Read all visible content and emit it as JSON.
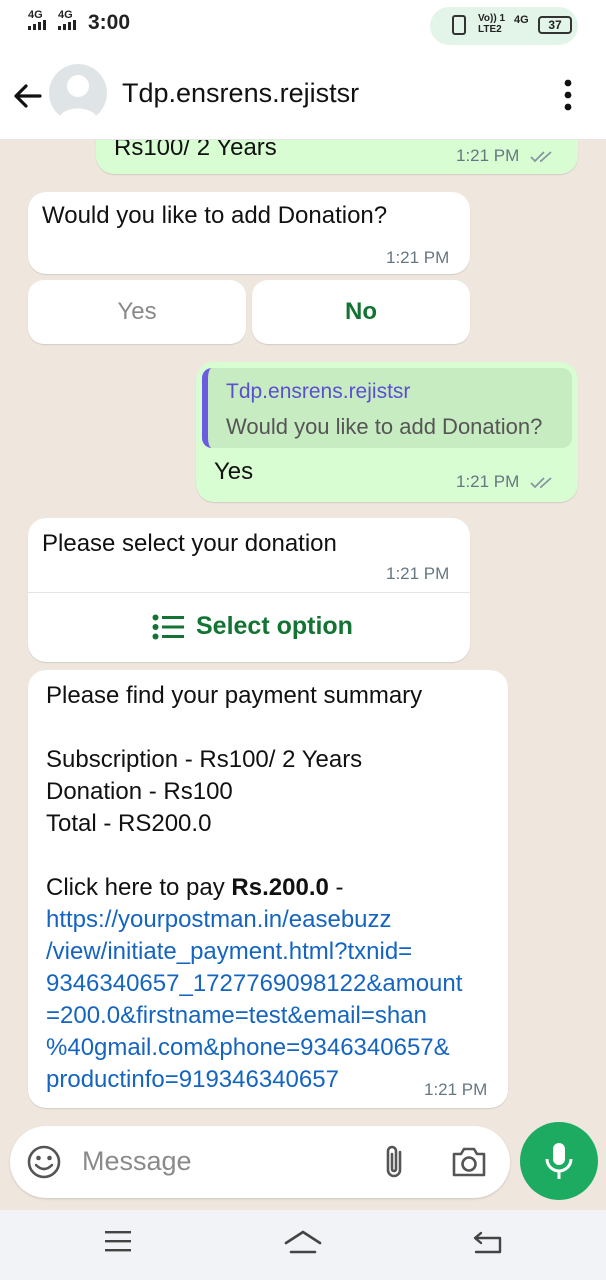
{
  "status_bar": {
    "net1": "4G",
    "net2": "4G",
    "time": "3:00",
    "volte_line1": "Vo)) 1",
    "volte_line2": "LTE2",
    "net3": "4G",
    "battery": "37"
  },
  "header": {
    "contact_name": "Tdp.ensrens.rejistsr"
  },
  "messages": {
    "m0": {
      "text": "Rs100/ 2 Years",
      "time": "1:21 PM"
    },
    "m1": {
      "text": "Would you like to add Donation?",
      "time": "1:21 PM"
    },
    "quick_replies": {
      "yes": "Yes",
      "no": "No"
    },
    "m2": {
      "quote_name": "Tdp.ensrens.rejistsr",
      "quote_text": "Would you like to add Donation?",
      "text": "Yes",
      "time": "1:21 PM"
    },
    "m3": {
      "text": "Please select your donation",
      "time": "1:21 PM",
      "action": "Select option"
    },
    "m4": {
      "line1": "Please find your payment summary",
      "line2": "Subscription - Rs100/ 2 Years",
      "line3": "Donation - Rs100",
      "line4": "Total - RS200.0",
      "pay_prefix": "Click here to pay",
      "pay_amount": "Rs.200.0",
      "pay_suffix": "-",
      "link_lines": [
        "https://yourpostman.in/easebuzz",
        "/view/initiate_payment.html?txnid=",
        "9346340657_1727769098122&amount",
        "=200.0&firstname=test&email=shan",
        "%40gmail.com&phone=9346340657&",
        "productinfo=919346340657"
      ],
      "time": "1:21 PM"
    }
  },
  "input": {
    "placeholder": "Message"
  },
  "colors": {
    "accent_green": "#1daa61",
    "button_green": "#137333",
    "outgoing_bubble": "#d9fdd3",
    "link": "#1565c0",
    "quote_name": "#5b4fd1"
  },
  "icons": [
    "back-arrow-icon",
    "avatar-person-icon",
    "more-vert-icon",
    "double-check-icon",
    "list-icon",
    "emoji-icon",
    "attach-icon",
    "camera-icon",
    "mic-icon",
    "menu-icon",
    "home-icon",
    "back-nav-icon"
  ]
}
